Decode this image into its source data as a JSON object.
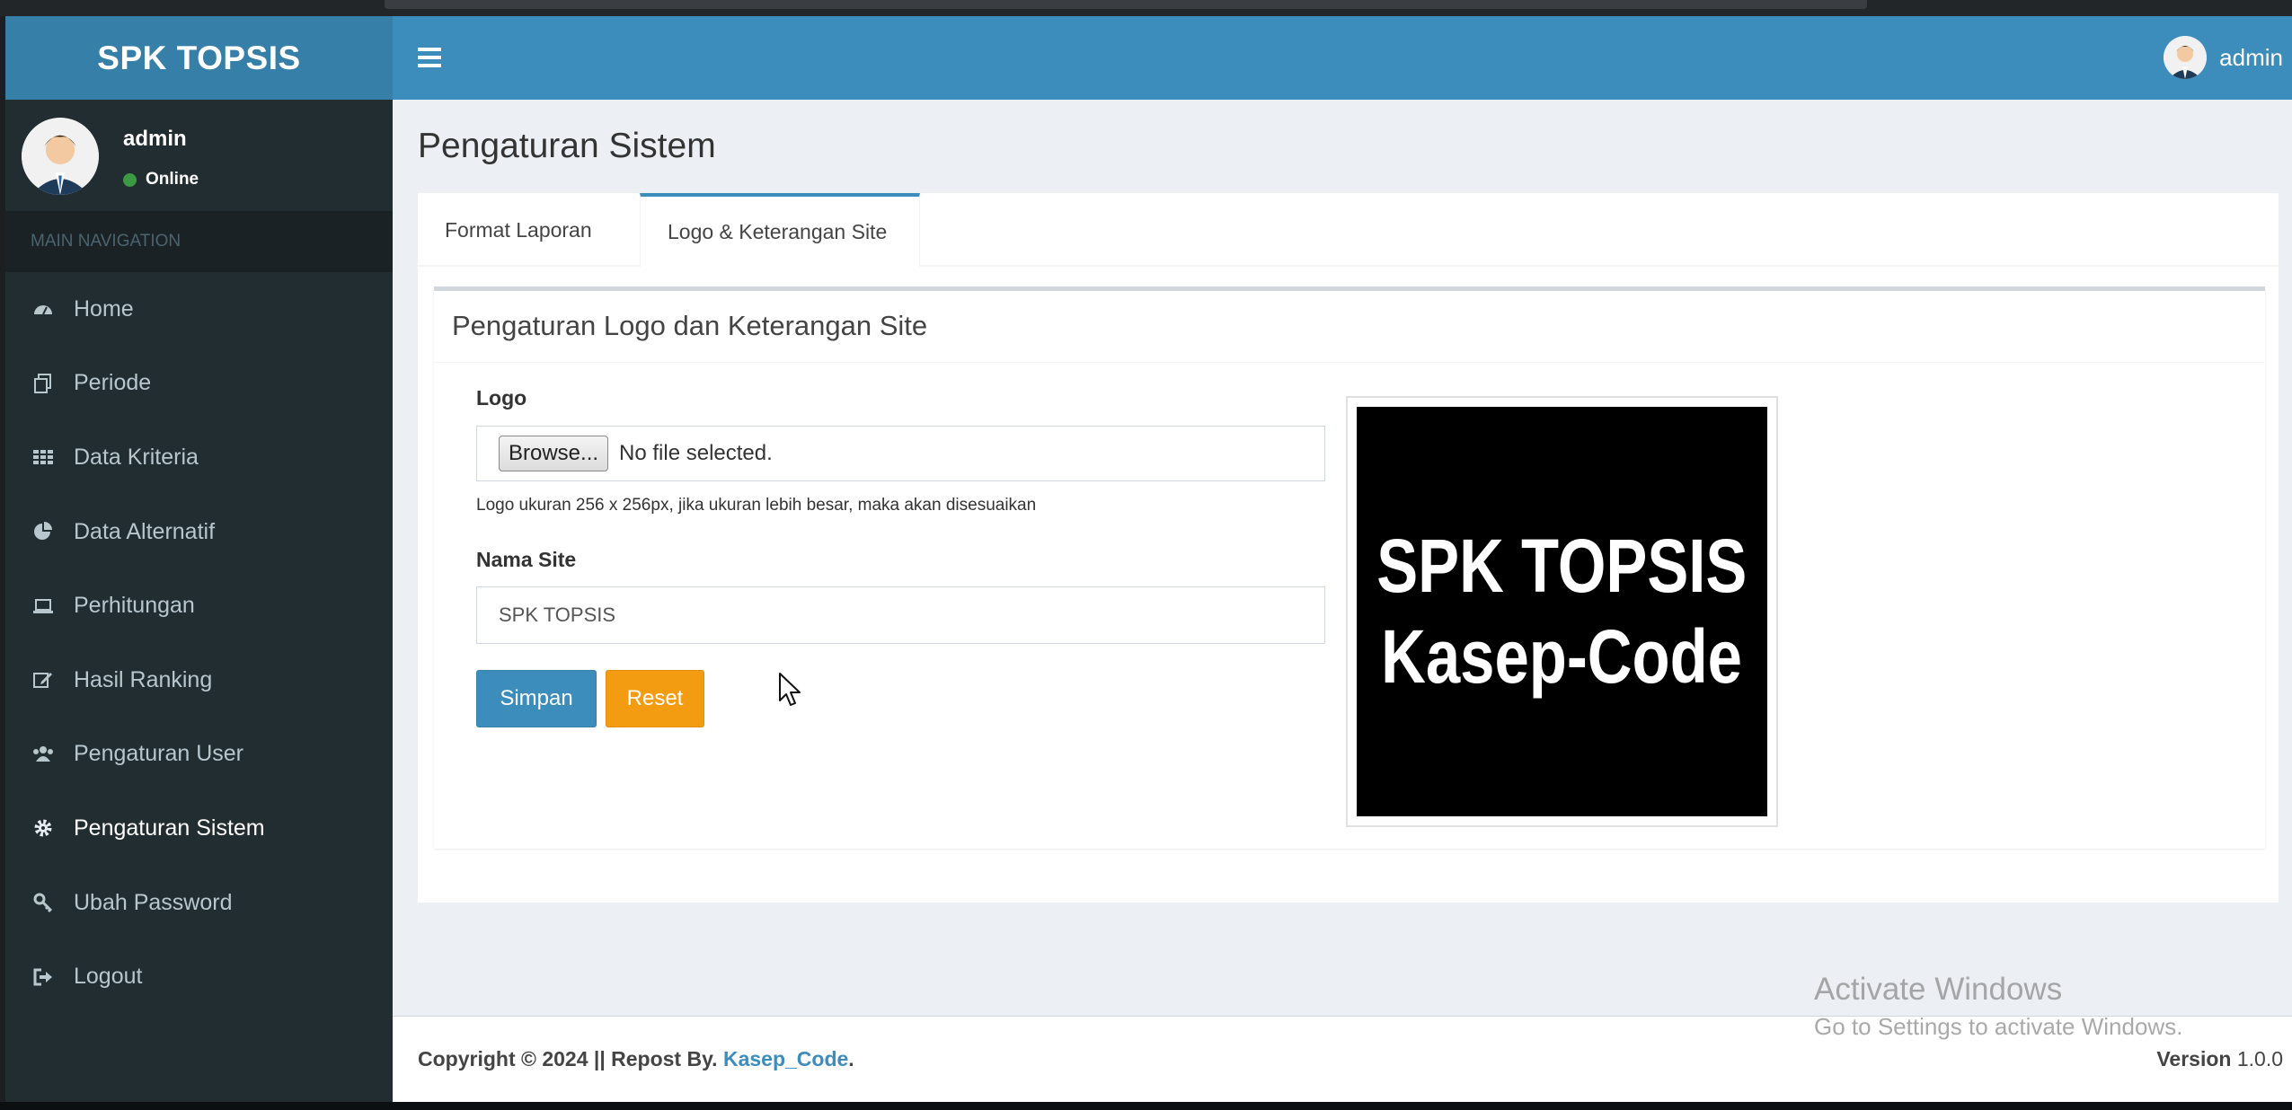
{
  "app": {
    "brand": "SPK TOPSIS",
    "header_user": "admin"
  },
  "sidebar": {
    "user_name": "admin",
    "user_status": "Online",
    "nav_header": "MAIN NAVIGATION",
    "items": [
      {
        "label": "Home",
        "icon": "dashboard-icon"
      },
      {
        "label": "Periode",
        "icon": "copy-icon"
      },
      {
        "label": "Data Kriteria",
        "icon": "grid-icon"
      },
      {
        "label": "Data Alternatif",
        "icon": "pie-chart-icon"
      },
      {
        "label": "Perhitungan",
        "icon": "laptop-icon"
      },
      {
        "label": "Hasil Ranking",
        "icon": "edit-icon"
      },
      {
        "label": "Pengaturan User",
        "icon": "users-icon"
      },
      {
        "label": "Pengaturan Sistem",
        "icon": "gear-icon"
      },
      {
        "label": "Ubah Password",
        "icon": "key-icon"
      },
      {
        "label": "Logout",
        "icon": "sign-out-icon"
      }
    ]
  },
  "page": {
    "title": "Pengaturan Sistem",
    "tabs": [
      {
        "label": "Format Laporan",
        "active": false
      },
      {
        "label": "Logo & Keterangan Site",
        "active": true
      }
    ],
    "panel_title": "Pengaturan Logo dan Keterangan Site",
    "form": {
      "logo_label": "Logo",
      "browse_label": "Browse...",
      "file_status": "No file selected.",
      "logo_help": "Logo ukuran 256 x 256px, jika ukuran lebih besar, maka akan disesuaikan",
      "site_name_label": "Nama Site",
      "site_name_value": "SPK TOPSIS",
      "save_label": "Simpan",
      "reset_label": "Reset"
    },
    "preview": {
      "line1": "SPK TOPSIS",
      "line2": "Kasep-Code"
    }
  },
  "footer": {
    "copyright_prefix": "Copyright © 2024 || Repost By.",
    "copyright_brand": "Kasep_Code",
    "copyright_suffix": ".",
    "version_label": "Version",
    "version_value": "1.0.0"
  },
  "watermark": {
    "line1": "Activate Windows",
    "line2": "Go to Settings to activate Windows."
  },
  "colors": {
    "header": "#3c8dbc",
    "logo_bg": "#367fa9",
    "sidebar": "#222d32",
    "primary": "#3c8dbc",
    "warning": "#f39c12",
    "online": "#3c9a43"
  }
}
